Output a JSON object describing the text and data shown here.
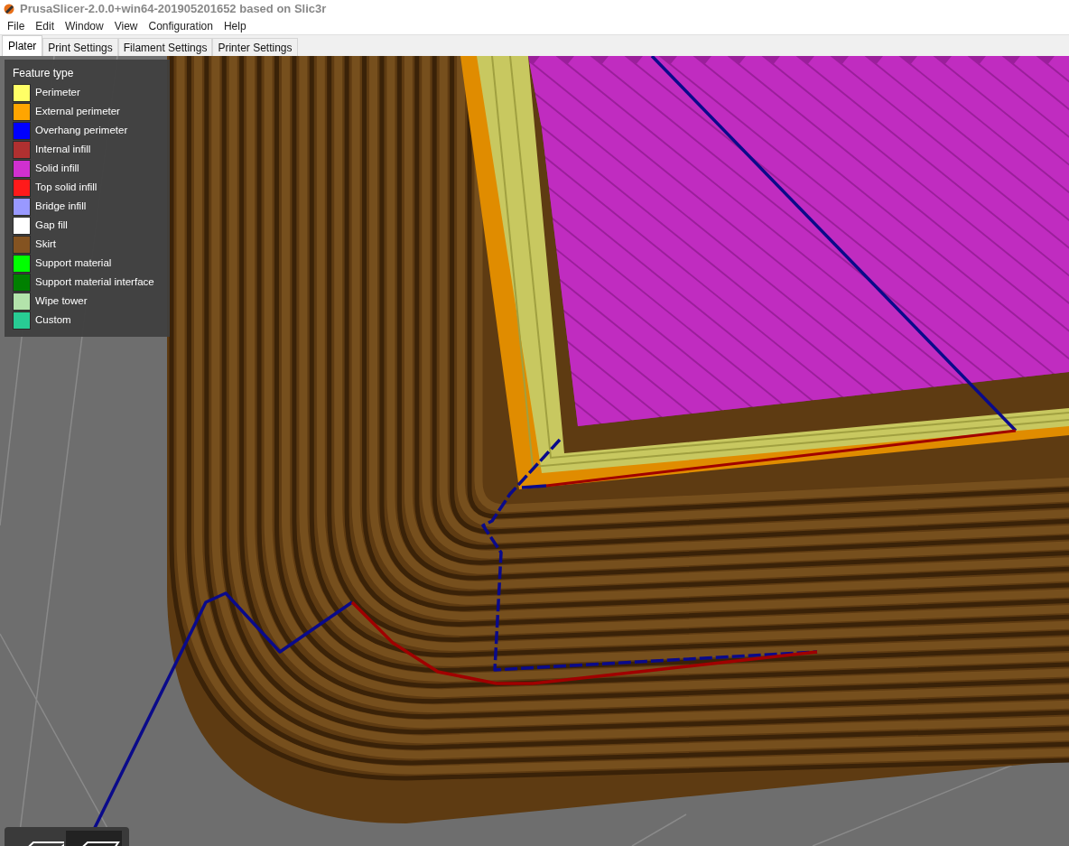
{
  "window": {
    "title": "PrusaSlicer-2.0.0+win64-201905201652 based on Slic3r"
  },
  "menu": [
    "File",
    "Edit",
    "Window",
    "View",
    "Configuration",
    "Help"
  ],
  "tabs": [
    {
      "label": "Plater",
      "selected": true
    },
    {
      "label": "Print Settings",
      "selected": false
    },
    {
      "label": "Filament Settings",
      "selected": false
    },
    {
      "label": "Printer Settings",
      "selected": false
    }
  ],
  "legend": {
    "title": "Feature type",
    "items": [
      {
        "name": "Perimeter",
        "color": "#ffff66"
      },
      {
        "name": "External perimeter",
        "color": "#ffa500"
      },
      {
        "name": "Overhang perimeter",
        "color": "#0000ff"
      },
      {
        "name": "Internal infill",
        "color": "#b03030"
      },
      {
        "name": "Solid infill",
        "color": "#d030d0"
      },
      {
        "name": "Top solid infill",
        "color": "#ff1a1a"
      },
      {
        "name": "Bridge infill",
        "color": "#9999ff"
      },
      {
        "name": "Gap fill",
        "color": "#ffffff"
      },
      {
        "name": "Skirt",
        "color": "#845321"
      },
      {
        "name": "Support material",
        "color": "#00ff00"
      },
      {
        "name": "Support material interface",
        "color": "#008000"
      },
      {
        "name": "Wipe tower",
        "color": "#b3e3ab"
      },
      {
        "name": "Custom",
        "color": "#28cc94"
      }
    ]
  }
}
